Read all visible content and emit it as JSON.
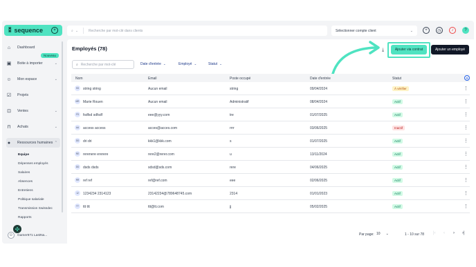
{
  "sidebar": {
    "logo": "sequence",
    "badge_new": "Nouveau",
    "items": [
      {
        "label": "Dashboard"
      },
      {
        "label": "Boite à importer"
      },
      {
        "label": "Mon espace"
      },
      {
        "label": "Projets"
      },
      {
        "label": "Ventes"
      },
      {
        "label": "Achats"
      },
      {
        "label": "Ressources humaines"
      }
    ],
    "subitems": [
      {
        "label": "Equipe"
      },
      {
        "label": "Dépenses employés"
      },
      {
        "label": "Salaires"
      },
      {
        "label": "Absences"
      },
      {
        "label": "Entretiens"
      },
      {
        "label": "Politique salariale"
      },
      {
        "label": "Transmission Swissdec"
      },
      {
        "label": "Rapports"
      }
    ],
    "user": "Gamer971 LastNa..."
  },
  "topbar": {
    "search_placeholder": "Recherche par mot-clé dans clients",
    "account_placeholder": "Sélectionner compte client"
  },
  "main": {
    "title": "Employés (78)",
    "btn_contrat": "Ajouter via contrat",
    "btn_add": "Ajouter un employé",
    "search_placeholder": "Recherche par mot-clé",
    "filters": {
      "date": "Date d'entrée",
      "employe": "Employé",
      "statut": "Statut"
    },
    "columns": {
      "nom": "Nom",
      "email": "Email",
      "poste": "Poste occupé",
      "date": "Date d'entrée",
      "statut": "Statut"
    },
    "rows": [
      {
        "initials": "SS",
        "name": "string string",
        "email": "Aucun email",
        "poste": "string",
        "date": "09/04/2024",
        "status": "À vérifier",
        "st": "verif"
      },
      {
        "initials": "MR",
        "name": "Marie Rouen",
        "email": "Aucun email",
        "poste": "Administratif",
        "date": "08/04/2024",
        "status": "Actif",
        "st": "actif"
      },
      {
        "initials": "FS",
        "name": "fsdfsd sdfsdf",
        "email": "eee@yyy.com",
        "poste": "tre",
        "date": "01/07/2025",
        "status": "Actif",
        "st": "actif"
      },
      {
        "initials": "AA",
        "name": "access access",
        "email": "acces@acces.com",
        "poste": "rrrr",
        "date": "03/06/2025",
        "status": "Inactif",
        "st": "inactif"
      },
      {
        "initials": "DD",
        "name": "dri dri",
        "email": "kkk1@kkk.com",
        "poste": "s",
        "date": "01/07/2025",
        "status": "Actif",
        "st": "actif"
      },
      {
        "initials": "RE",
        "name": "rerenere ererere",
        "email": "rere2@rerer.com",
        "poste": "u",
        "date": "13/11/2024",
        "status": "Actif",
        "st": "actif"
      },
      {
        "initials": "DD",
        "name": "dsds dsds",
        "email": "sdsd@sds.com",
        "poste": "rere",
        "date": "04/06/2025",
        "status": "Actif",
        "st": "actif"
      },
      {
        "initials": "RR",
        "name": "ref ref",
        "email": "ref@ref.com",
        "poste": "eee",
        "date": "02/06/2025",
        "status": "Actif",
        "st": "actif"
      },
      {
        "initials": "12",
        "name": "1234234 2314123",
        "email": "23142234@789648745.com",
        "poste": "2314",
        "date": "01/01/2023",
        "status": "Actif",
        "st": "actif"
      },
      {
        "initials": "TT",
        "name": "ttt ttt",
        "email": "ttt@tt.com",
        "poste": "jj",
        "date": "05/02/2025",
        "status": "Actif",
        "st": "actif"
      }
    ],
    "pager": {
      "per_page_label": "Par page:",
      "per_page": "10",
      "range": "1 - 10 sur 78"
    }
  },
  "colors": {
    "accent": "#4fe3c1",
    "dark": "#111827"
  }
}
